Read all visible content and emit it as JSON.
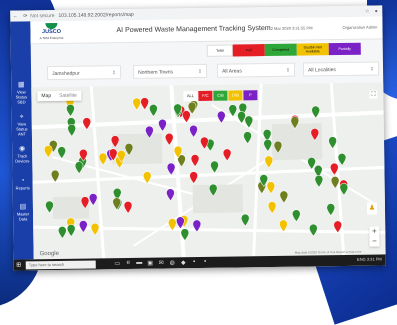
{
  "browser": {
    "security_label": "Not secure",
    "url": "103.105.148.92:2002/reports/map"
  },
  "sidebar": {
    "items": [
      {
        "label": "View Status SBD",
        "icon": "grid-icon"
      },
      {
        "label": "View Status ANT",
        "icon": "pin-icon"
      },
      {
        "label": "Track Devices",
        "icon": "track-icon"
      },
      {
        "label": "Reports",
        "icon": "reports-icon"
      },
      {
        "label": "Master Data",
        "icon": "master-data-icon"
      }
    ]
  },
  "header": {
    "logo_text": "JUSCO",
    "logo_sub": "A TATA Enterprise",
    "title": "AI Powered Waste Management Tracking System",
    "timestamp": "12 Mar 2020 3:31:55 PM",
    "org_label": "Organization Admin"
  },
  "legend": [
    {
      "label": "Total",
      "color": "#ffffff"
    },
    {
      "label": "Full",
      "color": "#e51e25"
    },
    {
      "label": "Completed",
      "color": "#2fa738"
    },
    {
      "label": "Dustbin Not Available",
      "color": "#f2c100"
    },
    {
      "label": "Partially",
      "color": "#7b22c6"
    }
  ],
  "filters": {
    "city": "Jamshedpur",
    "zone": "Northern Towns",
    "area": "All Areas",
    "locality": "All Localities"
  },
  "map": {
    "tabs": [
      "Map",
      "Satellite"
    ],
    "filter_buttons": [
      {
        "label": "ALL",
        "color": "#ffffff",
        "text": "#333333"
      },
      {
        "label": "F/C",
        "color": "#e51e25",
        "text": "#ffffff"
      },
      {
        "label": "C/B",
        "color": "#2fa738",
        "text": "#ffffff"
      },
      {
        "label": "D/B",
        "color": "#f2c100",
        "text": "#ffffff"
      },
      {
        "label": "P",
        "color": "#7b22c6",
        "text": "#ffffff"
      }
    ],
    "google_label": "Google",
    "terms": "Map data ©2020  Terms of Use  Report a map error"
  },
  "taskbar": {
    "search_placeholder": "Type here to search",
    "tray": "ENG 3:31 PM"
  },
  "colors": {
    "red": "#e51e25",
    "green": "#2f8f2f",
    "olive": "#6f7f1f",
    "yellow": "#f2c100",
    "purple": "#7b22c6",
    "sidebar": "#1b3fa8"
  }
}
